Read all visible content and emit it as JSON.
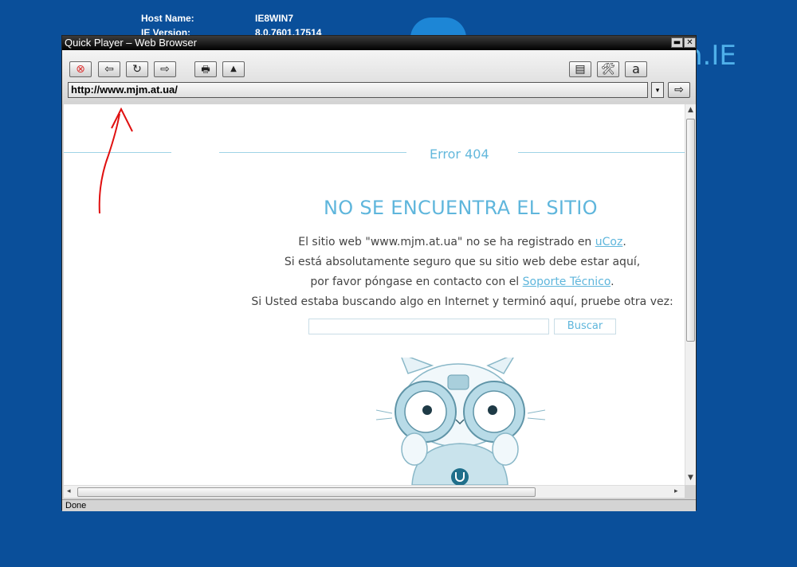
{
  "desktop": {
    "host_label": "Host Name:",
    "host_value": "IE8WIN7",
    "ie_label": "IE Version:",
    "ie_value": "8.0.7601.17514",
    "logo_text": "n.IE"
  },
  "window": {
    "title": "Quick Player – Web Browser",
    "minimize": "▬",
    "close": "✕"
  },
  "toolbar": {
    "stop": "⊗",
    "back": "⇦",
    "refresh": "↻",
    "forward": "⇨",
    "print": "🖶",
    "up": "▲",
    "page": "▤",
    "tools": "🛠",
    "font": "a"
  },
  "address": {
    "url": "http://www.mjm.at.ua/",
    "dropdown": "▾",
    "go": "⇨"
  },
  "page": {
    "error": "Error 404",
    "heading": "NO SE ENCUENTRA EL SITIO",
    "line1_pre": "El sitio web \"www.mjm.at.ua\" no se ha registrado en ",
    "line1_link": "uCoz",
    "line1_post": ".",
    "line2": "Si está absolutamente seguro que su sitio web debe estar aquí,",
    "line3_pre": "por favor póngase en contacto con el ",
    "line3_link": "Soporte Técnico",
    "line3_post": ".",
    "line4": "Si Usted estaba buscando algo en Internet y terminó aquí, pruebe otra vez:",
    "search_value": "",
    "search_button": "Buscar"
  },
  "status": {
    "text": "Done"
  },
  "colors": {
    "desktop_bg": "#0a4f9a",
    "accent": "#5fb6dc",
    "annotation": "#e01010"
  }
}
